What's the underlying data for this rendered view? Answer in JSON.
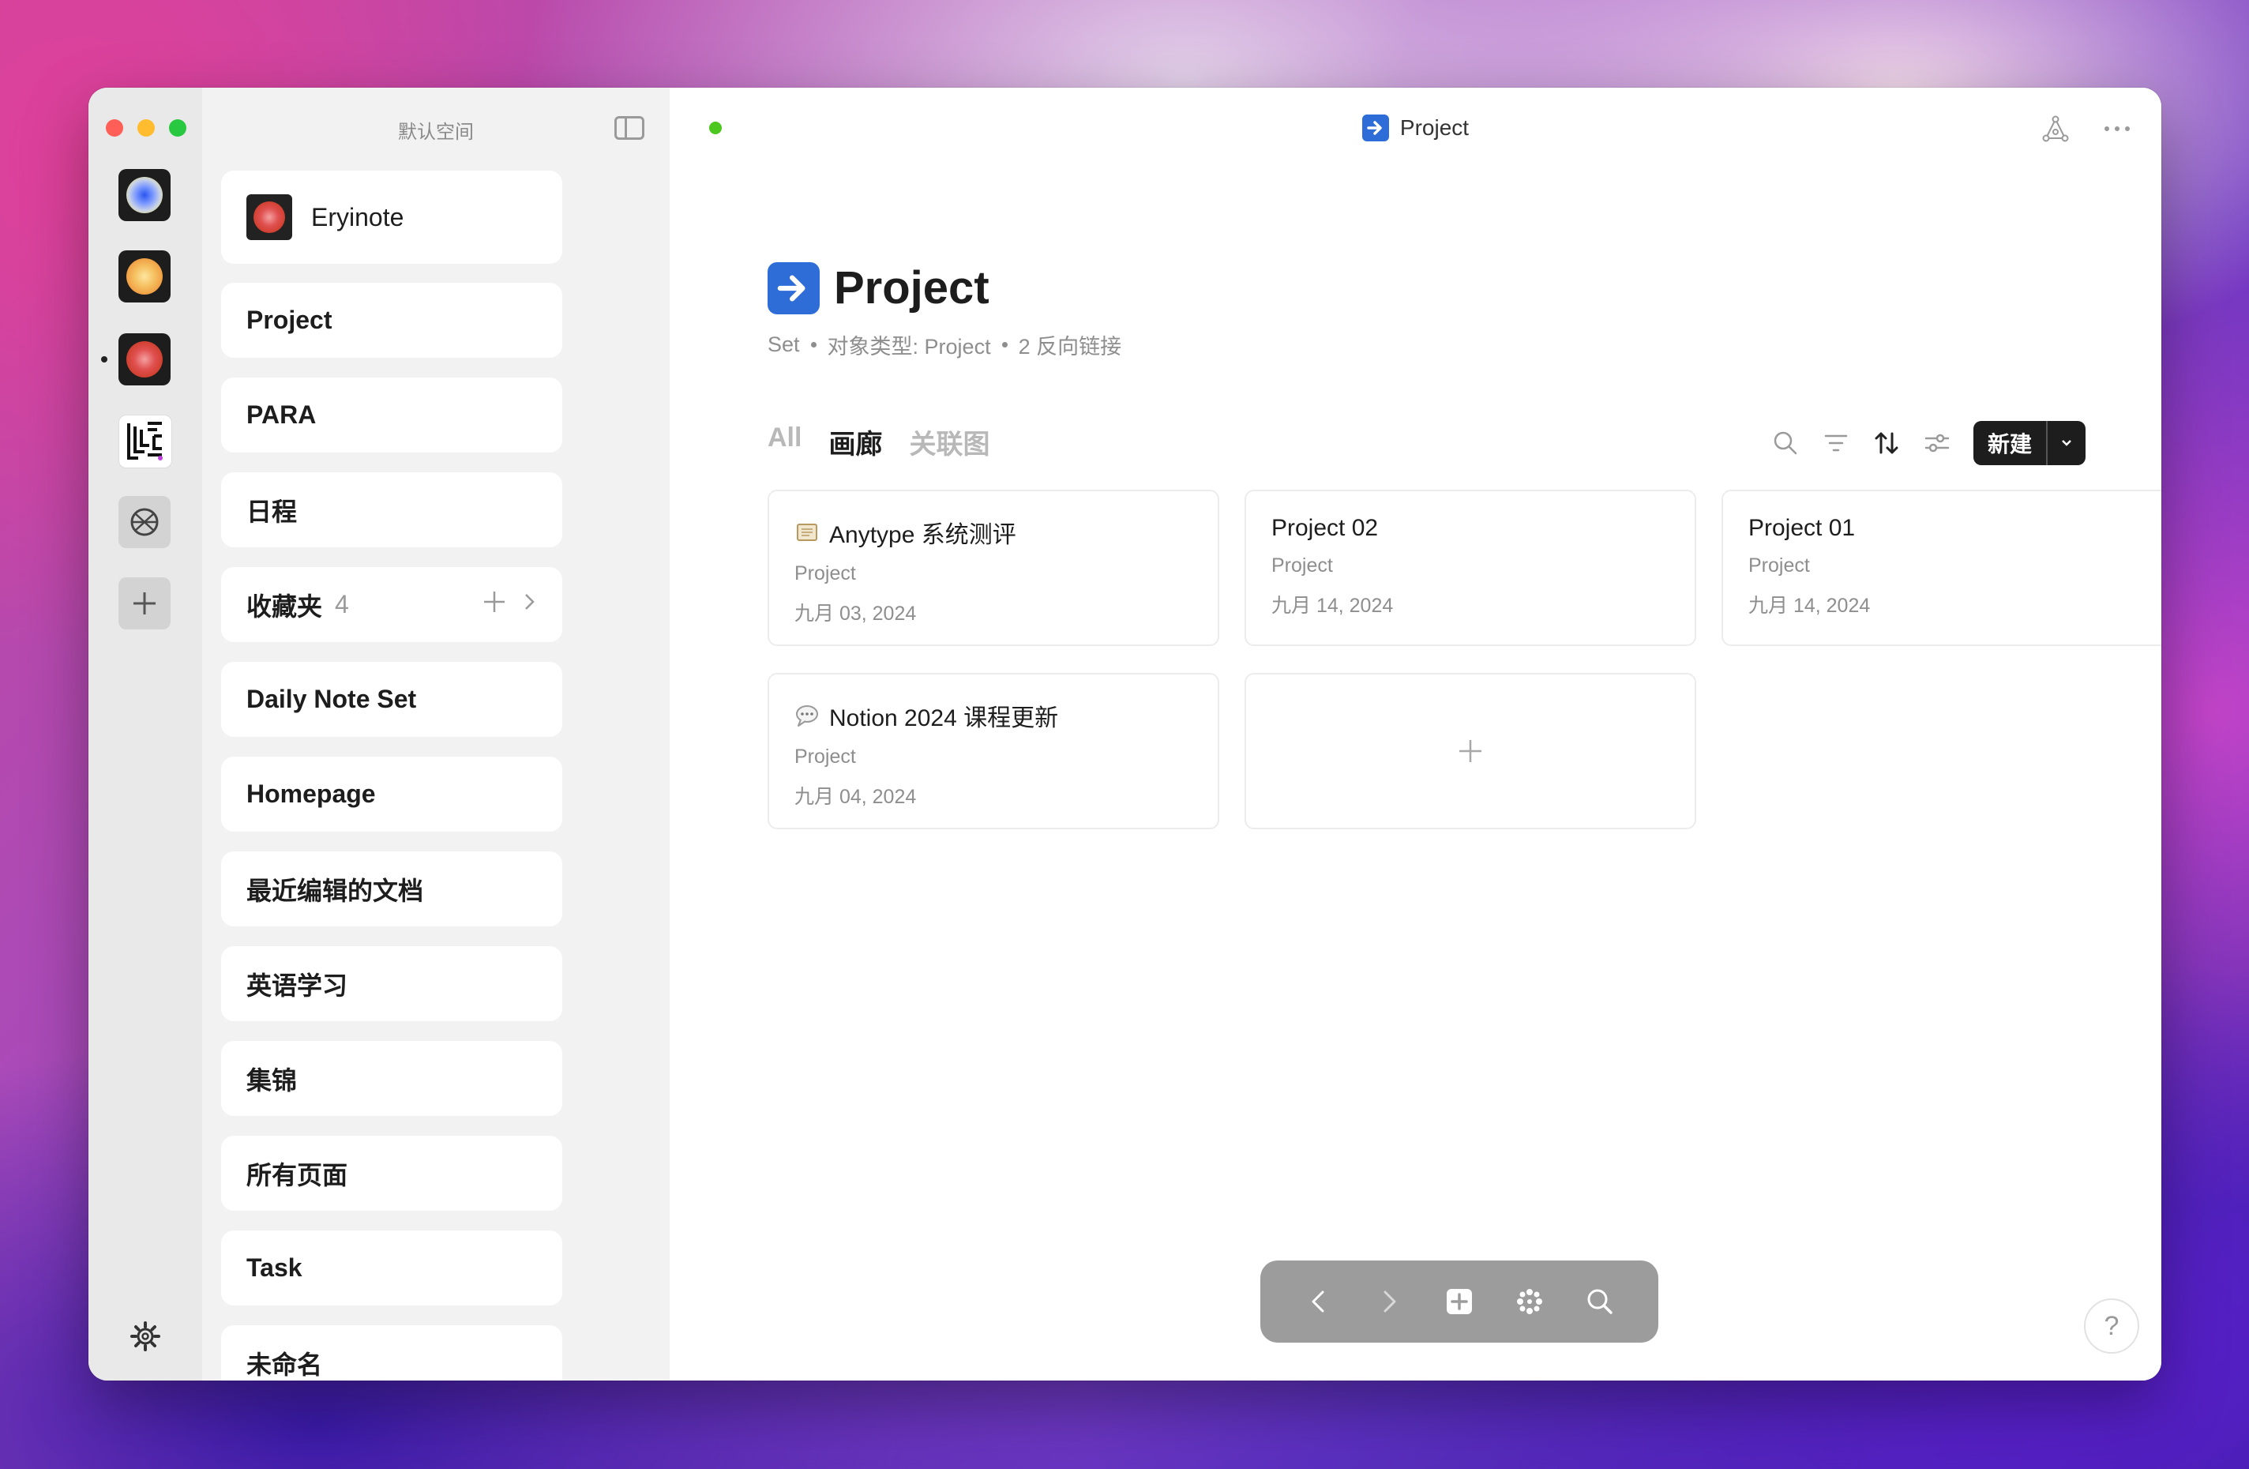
{
  "window": {
    "traffic_colors": [
      "#ff5f57",
      "#febc2e",
      "#28c840"
    ]
  },
  "rail": {
    "spaces": [
      {
        "name": "space-blue-orb",
        "colors": [
          "#2a55f0",
          "#9fb6ff",
          "#e8e080"
        ]
      },
      {
        "name": "space-yellow-orb",
        "colors": [
          "#f5d070",
          "#f0a040",
          "#e07a30"
        ]
      },
      {
        "name": "space-red-orb",
        "colors": [
          "#f5a0a0",
          "#e05050",
          "#8a2a2a"
        ],
        "active": true
      },
      {
        "name": "space-lrc-logo"
      },
      {
        "name": "space-globe-icon"
      }
    ],
    "add_label": "+"
  },
  "sidebar": {
    "space_name": "默认空间",
    "items": [
      {
        "label": "Eryinote"
      },
      {
        "label": "Project"
      },
      {
        "label": "PARA"
      },
      {
        "label": "日程"
      },
      {
        "label": "收藏夹",
        "count": "4"
      },
      {
        "label": "Daily Note Set"
      },
      {
        "label": "Homepage"
      },
      {
        "label": "最近编辑的文档"
      },
      {
        "label": "英语学习"
      },
      {
        "label": "集锦"
      },
      {
        "label": "所有页面"
      },
      {
        "label": "Task"
      },
      {
        "label": "未命名"
      }
    ]
  },
  "topbar": {
    "title": "Project",
    "status_color": "#4bc71f"
  },
  "page": {
    "title": "Project",
    "meta": {
      "kind": "Set",
      "object_type": "对象类型: Project",
      "backlinks": "2 反向链接"
    },
    "tabs": [
      {
        "label": "All",
        "active": false
      },
      {
        "label": "画廊",
        "active": true
      },
      {
        "label": "关联图",
        "active": false
      }
    ],
    "new_button": "新建"
  },
  "cards": [
    {
      "icon": "scroll-emoji-icon",
      "title": "Anytype 系统测评",
      "type": "Project",
      "date": "九月 03, 2024"
    },
    {
      "icon": "",
      "title": "Project 02",
      "type": "Project",
      "date": "九月 14, 2024"
    },
    {
      "icon": "",
      "title": "Project 01",
      "type": "Project",
      "date": "九月 14, 2024"
    },
    {
      "icon": "speech-bubble-emoji-icon",
      "title": "Notion 2024 课程更新",
      "type": "Project",
      "date": "九月 04, 2024"
    }
  ],
  "help_label": "?"
}
